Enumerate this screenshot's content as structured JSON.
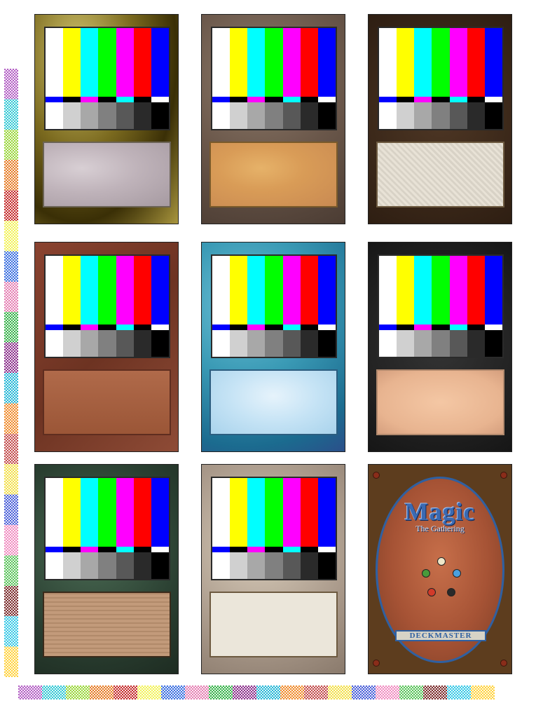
{
  "card_back": {
    "title": "Magic",
    "subtitle": "The Gathering",
    "deckmaster": "DECKMASTER"
  },
  "colors": {
    "bars": [
      "#ffffff",
      "#ffff00",
      "#00ffff",
      "#00ff00",
      "#ff00ff",
      "#ff0000",
      "#0000ff"
    ],
    "mid": [
      "#0000ff",
      "#000000",
      "#ff00ff",
      "#000000",
      "#00ffff",
      "#000000",
      "#ffffff"
    ],
    "low": [
      "#ffffff",
      "#d0d0d0",
      "#a8a8a8",
      "#808080",
      "#585858",
      "#2a2a2a",
      "#000000"
    ]
  }
}
